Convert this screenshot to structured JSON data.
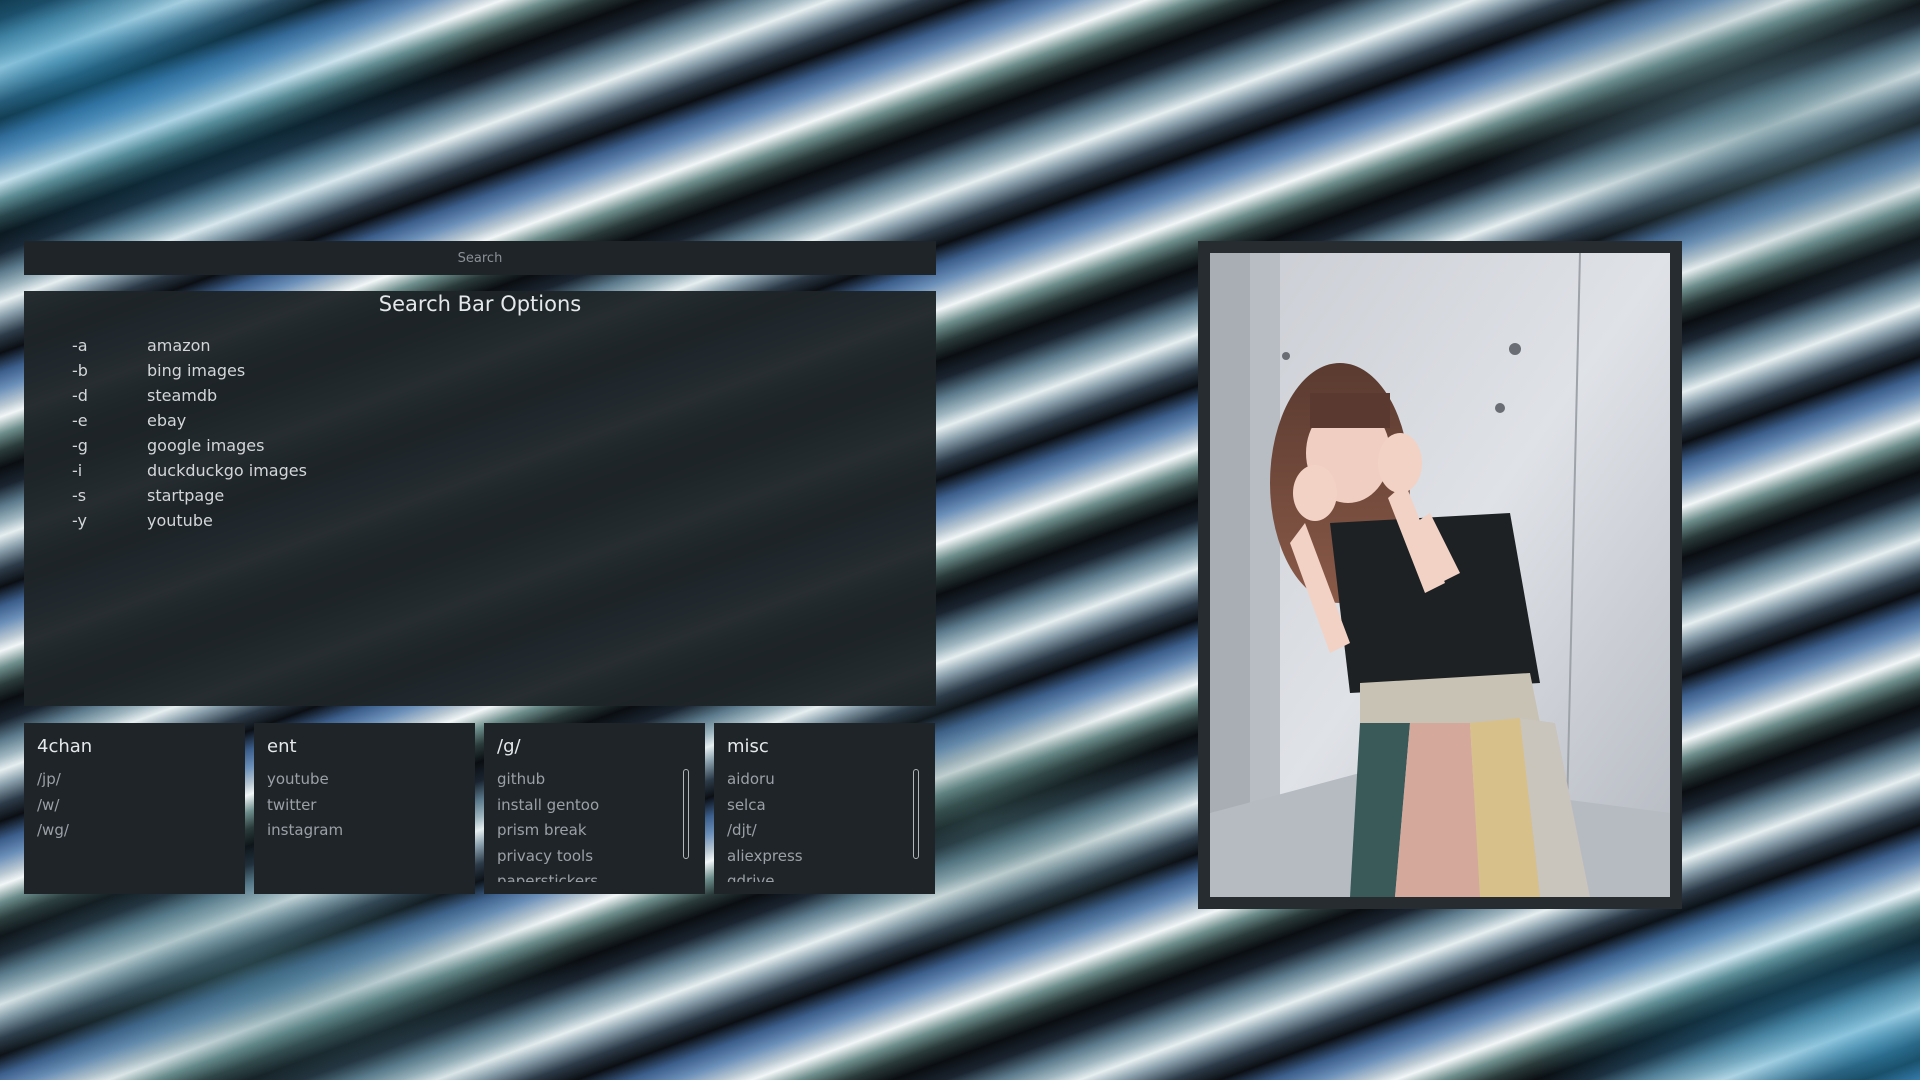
{
  "search": {
    "placeholder": "Search"
  },
  "options": {
    "title": "Search Bar Options",
    "items": [
      {
        "flag": "-a",
        "site": "amazon"
      },
      {
        "flag": "-b",
        "site": "bing images"
      },
      {
        "flag": "-d",
        "site": "steamdb"
      },
      {
        "flag": "-e",
        "site": "ebay"
      },
      {
        "flag": "-g",
        "site": "google images"
      },
      {
        "flag": "-i",
        "site": "duckduckgo images"
      },
      {
        "flag": "-s",
        "site": "startpage"
      },
      {
        "flag": "-y",
        "site": "youtube"
      }
    ]
  },
  "cards": [
    {
      "title": "4chan",
      "links": [
        "/jp/",
        "/w/",
        "/wg/"
      ]
    },
    {
      "title": "ent",
      "links": [
        "youtube",
        "twitter",
        "instagram"
      ]
    },
    {
      "title": "/g/",
      "links": [
        "github",
        "install gentoo",
        "prism break",
        "privacy tools",
        "paperstickers"
      ]
    },
    {
      "title": "misc",
      "links": [
        "aidoru",
        "selca",
        "/djt/",
        "aliexpress",
        "gdrive"
      ]
    }
  ],
  "colors": {
    "panel": "#1e2428",
    "text": "#d2d6d9",
    "link": "#9aa0a6"
  }
}
